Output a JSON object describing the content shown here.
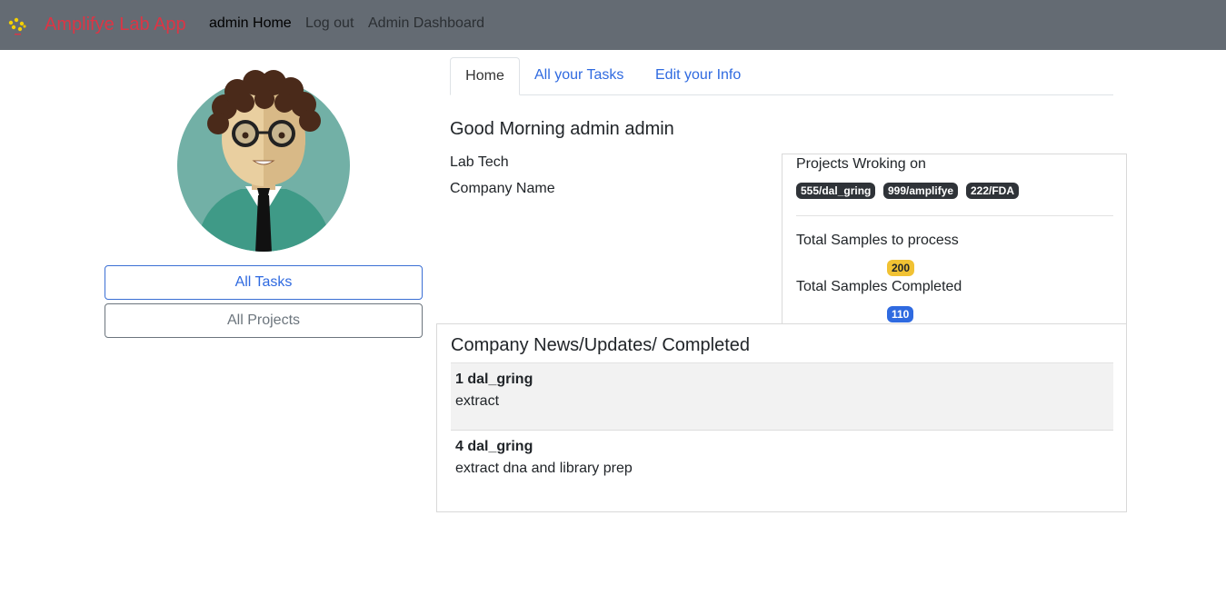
{
  "navbar": {
    "logo_icon": "dna-dots-icon",
    "brand": "Amplifye Lab App",
    "links": [
      {
        "label": "admin Home",
        "active": true
      },
      {
        "label": "Log out",
        "active": false
      },
      {
        "label": "Admin Dashboard",
        "active": false
      }
    ]
  },
  "sidebar": {
    "avatar_icon": "user-avatar",
    "buttons": [
      {
        "label": "All Tasks"
      },
      {
        "label": "All Projects"
      }
    ]
  },
  "tabs": [
    {
      "label": "Home",
      "active": true
    },
    {
      "label": "All your Tasks",
      "active": false
    },
    {
      "label": "Edit your Info",
      "active": false
    }
  ],
  "profile": {
    "greeting": "Good Morning admin admin",
    "role": "Lab Tech",
    "company": "Company Name"
  },
  "projects_card": {
    "title": "Projects Wroking on",
    "projects": [
      "555/dal_gring",
      "999/amplifye",
      "222/FDA"
    ],
    "samples_to_process_label": "Total Samples to process",
    "samples_to_process": "200",
    "samples_completed_label": "Total Samples Completed",
    "samples_completed": "110"
  },
  "news": {
    "title": "Company News/Updates/ Completed",
    "items": [
      {
        "heading": "1 dal_gring",
        "body": "extract"
      },
      {
        "heading": "4 dal_gring",
        "body": "extract dna and library prep"
      }
    ]
  },
  "colors": {
    "navbar_bg": "#646b73",
    "brand": "#dc3545",
    "primary": "#2f6ae0",
    "warning": "#f1c233",
    "dark_badge": "#2f3338"
  }
}
